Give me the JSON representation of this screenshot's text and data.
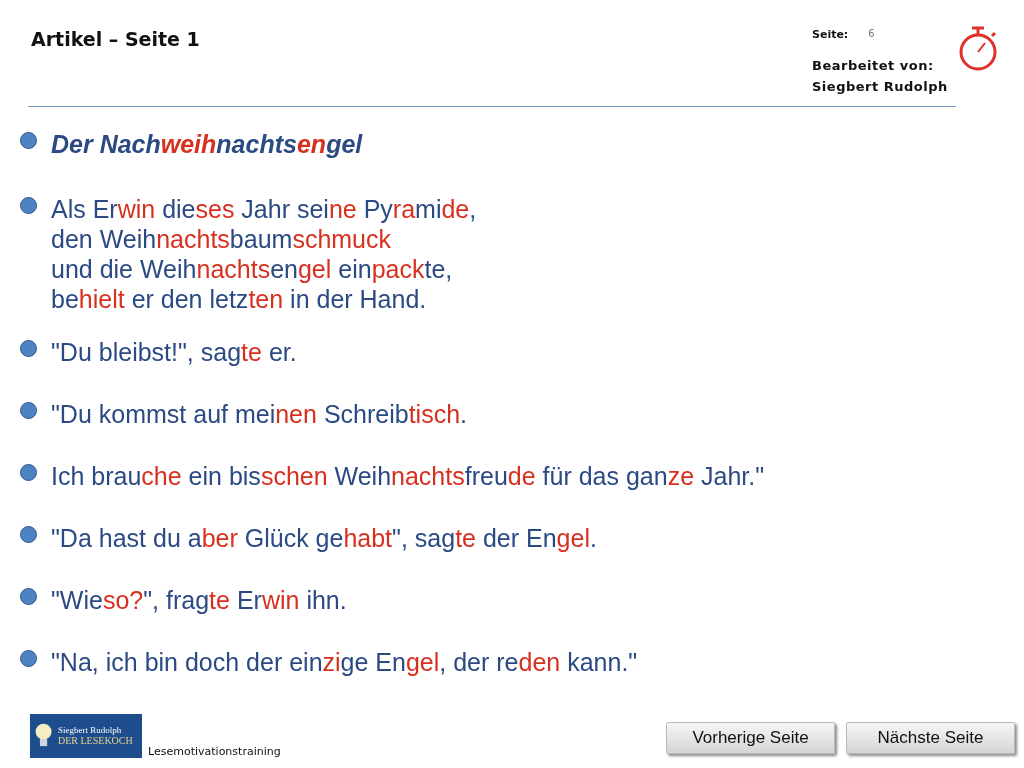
{
  "header": {
    "title": "Artikel – Seite 1",
    "page_label": "Seite:",
    "page_number": "6",
    "editor_label": "Bearbeitet von:",
    "editor_name": "Siegbert Rudolph"
  },
  "paragraphs": [
    {
      "kind": "title",
      "lines": [
        [
          {
            "text": "Der Nach",
            "red": false
          },
          {
            "text": "weih",
            "red": true
          },
          {
            "text": "nachts",
            "red": false
          },
          {
            "text": "en",
            "red": true
          },
          {
            "text": "gel",
            "red": false
          }
        ]
      ]
    },
    {
      "kind": "text",
      "lines": [
        [
          {
            "text": "Als Er",
            "red": false
          },
          {
            "text": "win",
            "red": true
          },
          {
            "text": " die",
            "red": false
          },
          {
            "text": "ses",
            "red": true
          },
          {
            "text": " Jahr sei",
            "red": false
          },
          {
            "text": "ne",
            "red": true
          },
          {
            "text": " Py",
            "red": false
          },
          {
            "text": "ra",
            "red": true
          },
          {
            "text": "mi",
            "red": false
          },
          {
            "text": "de",
            "red": true
          },
          {
            "text": ",",
            "red": false
          }
        ],
        [
          {
            "text": "den Weih",
            "red": false
          },
          {
            "text": "nachts",
            "red": true
          },
          {
            "text": "baum",
            "red": false
          },
          {
            "text": "schmuck",
            "red": true
          }
        ],
        [
          {
            "text": "und die Weih",
            "red": false
          },
          {
            "text": "nachts",
            "red": true
          },
          {
            "text": "en",
            "red": false
          },
          {
            "text": "gel",
            "red": true
          },
          {
            "text": " ein",
            "red": false
          },
          {
            "text": "pack",
            "red": true
          },
          {
            "text": "te,",
            "red": false
          }
        ],
        [
          {
            "text": "be",
            "red": false
          },
          {
            "text": "hielt",
            "red": true
          },
          {
            "text": " er den letz",
            "red": false
          },
          {
            "text": "ten",
            "red": true
          },
          {
            "text": " in der Hand.",
            "red": false
          }
        ]
      ]
    },
    {
      "kind": "text",
      "lines": [
        [
          {
            "text": "\"Du bleibst!\", sag",
            "red": false
          },
          {
            "text": "te",
            "red": true
          },
          {
            "text": " er.",
            "red": false
          }
        ]
      ]
    },
    {
      "kind": "text",
      "lines": [
        [
          {
            "text": "\"Du kommst auf mei",
            "red": false
          },
          {
            "text": "nen",
            "red": true
          },
          {
            "text": " Schreib",
            "red": false
          },
          {
            "text": "tisch",
            "red": true
          },
          {
            "text": ".",
            "red": false
          }
        ]
      ]
    },
    {
      "kind": "text",
      "lines": [
        [
          {
            "text": "Ich brau",
            "red": false
          },
          {
            "text": "che",
            "red": true
          },
          {
            "text": " ein bis",
            "red": false
          },
          {
            "text": "schen",
            "red": true
          },
          {
            "text": " Weih",
            "red": false
          },
          {
            "text": "nachts",
            "red": true
          },
          {
            "text": "freu",
            "red": false
          },
          {
            "text": "de",
            "red": true
          },
          {
            "text": " für das gan",
            "red": false
          },
          {
            "text": "ze",
            "red": true
          },
          {
            "text": " Jahr.\"",
            "red": false
          }
        ]
      ]
    },
    {
      "kind": "text",
      "lines": [
        [
          {
            "text": "\"Da hast du a",
            "red": false
          },
          {
            "text": "ber",
            "red": true
          },
          {
            "text": " Glück ge",
            "red": false
          },
          {
            "text": "habt",
            "red": true
          },
          {
            "text": "\", sag",
            "red": false
          },
          {
            "text": "te",
            "red": true
          },
          {
            "text": " der En",
            "red": false
          },
          {
            "text": "gel",
            "red": true
          },
          {
            "text": ".",
            "red": false
          }
        ]
      ]
    },
    {
      "kind": "text",
      "lines": [
        [
          {
            "text": "\"Wie",
            "red": false
          },
          {
            "text": "so?",
            "red": true
          },
          {
            "text": "\", frag",
            "red": false
          },
          {
            "text": "te",
            "red": true
          },
          {
            "text": " Er",
            "red": false
          },
          {
            "text": "win",
            "red": true
          },
          {
            "text": " ihn.",
            "red": false
          }
        ]
      ]
    },
    {
      "kind": "text",
      "lines": [
        [
          {
            "text": "\"Na, ich bin doch der ein",
            "red": false
          },
          {
            "text": "zi",
            "red": true
          },
          {
            "text": "ge En",
            "red": false
          },
          {
            "text": "gel",
            "red": true
          },
          {
            "text": ", der re",
            "red": false
          },
          {
            "text": "den",
            "red": true
          },
          {
            "text": " kann.\"",
            "red": false
          }
        ]
      ]
    }
  ],
  "footer": {
    "logo_author": "Siegbert Rudolph",
    "logo_title": "DER LESEKOCH",
    "caption": "Lesemotivationstraining",
    "buttons": [
      "Vorherige Seite",
      "Nächste Seite"
    ]
  }
}
